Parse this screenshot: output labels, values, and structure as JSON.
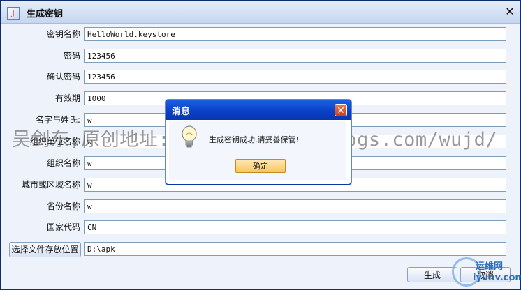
{
  "window": {
    "title": "生成密钥",
    "close_glyph": "✕",
    "app_icon_glyph": "J"
  },
  "form": {
    "rows": [
      {
        "label": "密钥名称",
        "value": "HelloWorld.keystore"
      },
      {
        "label": "密码",
        "value": "123456"
      },
      {
        "label": "确认密码",
        "value": "123456"
      },
      {
        "label": "有效期",
        "value": "1000"
      },
      {
        "label": "名字与姓氏:",
        "value": "w"
      },
      {
        "label": "组织单位名称",
        "value": "w"
      },
      {
        "label": "组织名称",
        "value": "w"
      },
      {
        "label": "城市或区域名称",
        "value": "w"
      },
      {
        "label": "省份名称",
        "value": "w"
      },
      {
        "label": "国家代码",
        "value": "CN"
      }
    ],
    "choose_location_label": "选择文件存放位置",
    "location_value": "D:\\apk"
  },
  "buttons": {
    "generate": "生成",
    "cancel": "取消"
  },
  "watermark": "吴剑东,原创地址:http://www.cnblogs.com/wujd/",
  "dialog": {
    "title": "消息",
    "close_glyph": "✕",
    "message": "生成密钥成功,请妥善保管!",
    "ok_label": "确定",
    "icon": "lightbulb-icon"
  },
  "site_logo": {
    "line1": "运维网",
    "line2": "iyunv.com"
  },
  "colors": {
    "dialog_title": "#0a3ec4",
    "ok_button": "#f7c561",
    "close_button": "#c8401c"
  }
}
